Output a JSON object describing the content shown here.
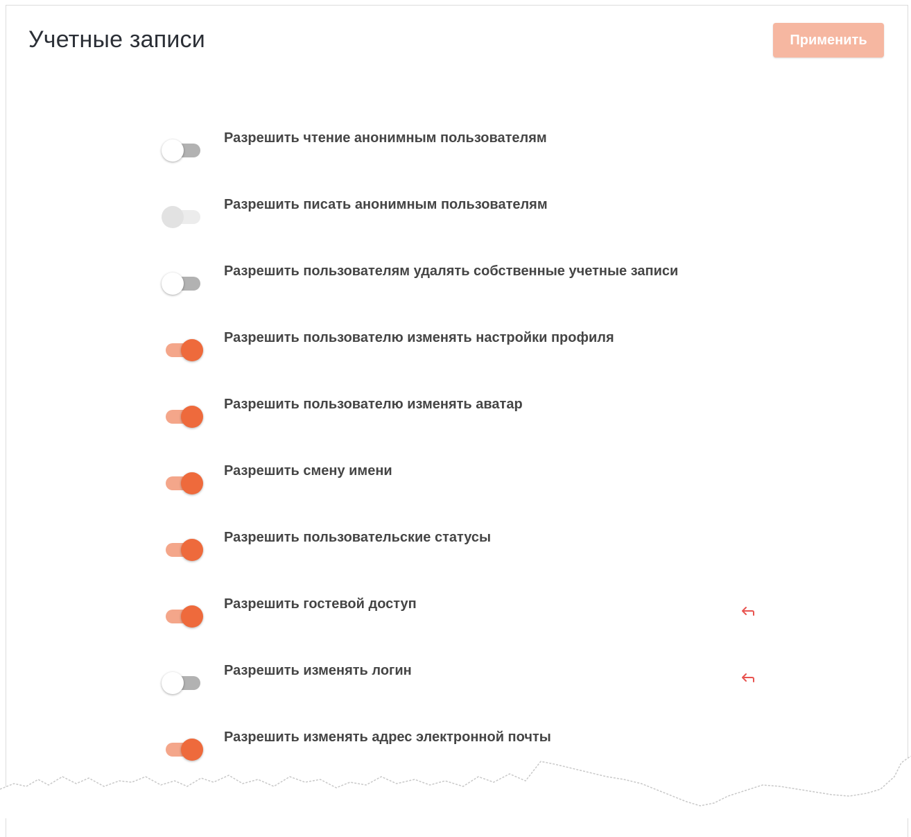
{
  "header": {
    "title": "Учетные записи",
    "apply_label": "Применить"
  },
  "colors": {
    "accent": "#ee6a3c",
    "accent_track": "#f4a68a",
    "apply_disabled": "#f6b7a1",
    "reset_icon": "#e8534f"
  },
  "settings": [
    {
      "label": "Разрешить чтение анонимным пользователям",
      "enabled": false,
      "disabled": false,
      "changed": false
    },
    {
      "label": "Разрешить писать анонимным пользователям",
      "enabled": false,
      "disabled": true,
      "changed": false
    },
    {
      "label": "Разрешить пользователям удалять собственные учетные записи",
      "enabled": false,
      "disabled": false,
      "changed": false
    },
    {
      "label": "Разрешить пользователю изменять настройки профиля",
      "enabled": true,
      "disabled": false,
      "changed": false
    },
    {
      "label": "Разрешить пользователю изменять аватар",
      "enabled": true,
      "disabled": false,
      "changed": false
    },
    {
      "label": "Разрешить смену имени",
      "enabled": true,
      "disabled": false,
      "changed": false
    },
    {
      "label": "Разрешить пользовательские статусы",
      "enabled": true,
      "disabled": false,
      "changed": false
    },
    {
      "label": "Разрешить гостевой доступ",
      "enabled": true,
      "disabled": false,
      "changed": true
    },
    {
      "label": "Разрешить изменять логин",
      "enabled": false,
      "disabled": false,
      "changed": true
    },
    {
      "label": "Разрешить изменять адрес электронной почты",
      "enabled": true,
      "disabled": false,
      "changed": false
    }
  ],
  "icons": {
    "reset": "undo-arrow-icon"
  }
}
